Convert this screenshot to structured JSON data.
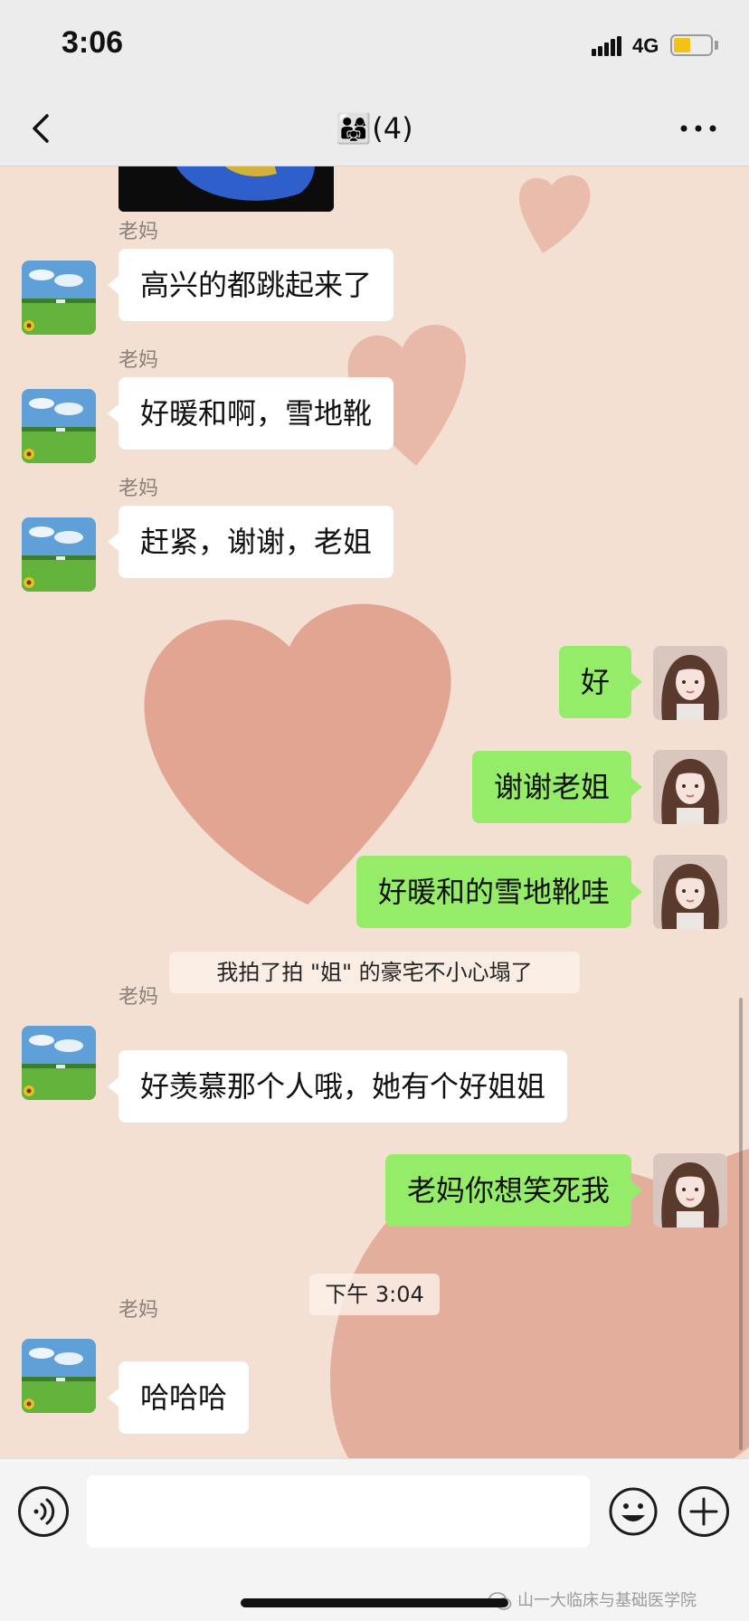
{
  "status_bar": {
    "time": "3:06",
    "network": "4G",
    "battery_level": 0.45
  },
  "nav": {
    "title_emoji": "👨‍👩‍👧",
    "title_count": "(4)",
    "back_icon": "chevron-left-icon",
    "more_icon": "ellipsis-icon"
  },
  "messages": [
    {
      "type": "image",
      "side": "in",
      "description_icon": "photo-thumbnail"
    },
    {
      "type": "text",
      "side": "in",
      "sender": "老妈",
      "text": "高兴的都跳起来了"
    },
    {
      "type": "text",
      "side": "in",
      "sender": "老妈",
      "text": "好暖和啊，雪地靴"
    },
    {
      "type": "text",
      "side": "in",
      "sender": "老妈",
      "text": "赶紧，谢谢，老姐"
    },
    {
      "type": "text",
      "side": "out",
      "text": "好"
    },
    {
      "type": "text",
      "side": "out",
      "text": "谢谢老姐"
    },
    {
      "type": "text",
      "side": "out",
      "text": "好暖和的雪地靴哇"
    },
    {
      "type": "system",
      "text": "我拍了拍 \"姐\" 的豪宅不小心塌了"
    },
    {
      "type": "text",
      "side": "in",
      "sender": "老妈",
      "text": "好羡慕那个人哦，她有个好姐姐"
    },
    {
      "type": "text",
      "side": "out",
      "text": "老妈你想笑死我"
    },
    {
      "type": "time",
      "text": "下午 3:04"
    },
    {
      "type": "text",
      "side": "in",
      "sender": "老妈",
      "text": "哈哈哈"
    }
  ],
  "input_bar": {
    "placeholder": "",
    "voice_icon": "voice-icon",
    "emoji_icon": "emoji-icon",
    "plus_icon": "plus-icon"
  },
  "watermark": {
    "text": "山一大临床与基础医学院"
  },
  "colors": {
    "outgoing_bubble": "#95ec69",
    "incoming_bubble": "#ffffff",
    "chat_background": "#f3e0d3"
  }
}
